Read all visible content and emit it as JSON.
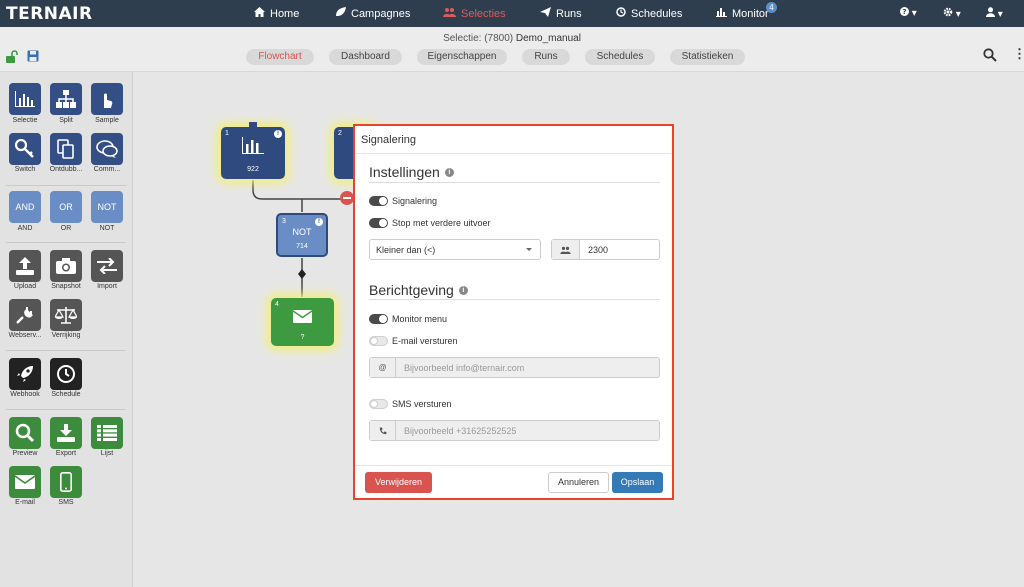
{
  "app": {
    "logo": "TERNAIR"
  },
  "nav": {
    "items": [
      {
        "label": "Home",
        "icon": "home-icon"
      },
      {
        "label": "Campagnes",
        "icon": "leaf-icon"
      },
      {
        "label": "Selecties",
        "icon": "users-icon",
        "active": true
      },
      {
        "label": "Runs",
        "icon": "paper-plane-icon"
      },
      {
        "label": "Schedules",
        "icon": "clock-icon"
      },
      {
        "label": "Monitor",
        "icon": "bar-chart-icon",
        "badge": "4"
      }
    ],
    "right": [
      "question-icon",
      "gear-icon",
      "user-icon"
    ]
  },
  "subheader": {
    "title_prefix": "Selectie: (7800)",
    "title_name": "Demo_manual",
    "tabs": [
      "Flowchart",
      "Dashboard",
      "Eigenschappen",
      "Runs",
      "Schedules",
      "Statistieken"
    ],
    "active_tab": "Flowchart"
  },
  "toolbar": {
    "groups": [
      [
        "Selectie",
        "Split",
        "Sample",
        "Switch",
        "Ontdubb...",
        "Comm..."
      ],
      [
        "AND",
        "OR",
        "NOT"
      ],
      [
        "Upload",
        "Snapshot",
        "Import",
        "Webserv...",
        "Verrijking"
      ],
      [
        "Webhook",
        "Schedule"
      ],
      [
        "Preview",
        "Export",
        "Lijst",
        "E-mail",
        "SMS"
      ]
    ],
    "logic_text": {
      "and": "AND",
      "or": "OR",
      "not": "NOT"
    }
  },
  "flow": {
    "node1": {
      "num": "1",
      "count": "922"
    },
    "node2": {
      "num": "2"
    },
    "node3": {
      "num": "3",
      "label": "NOT",
      "count": "714"
    },
    "node4": {
      "num": "4",
      "count": "?"
    }
  },
  "modal": {
    "title": "Signalering",
    "section1": "Instellingen",
    "toggle_signalering": "Signalering",
    "toggle_stop": "Stop met verdere uitvoer",
    "select_value": "Kleiner dan (<)",
    "threshold": "2300",
    "section2": "Berichtgeving",
    "toggle_monitor": "Monitor menu",
    "toggle_email": "E-mail versturen",
    "email_placeholder": "Bijvoorbeeld info@ternair.com",
    "toggle_sms": "SMS versturen",
    "sms_placeholder": "Bijvoorbeeld +31625252525",
    "btn_delete": "Verwijderen",
    "btn_cancel": "Annuleren",
    "btn_save": "Opslaan"
  },
  "colors": {
    "nav_bg": "#2f3e4e",
    "accent_red": "#d9534f",
    "node_blue": "#2e4a7e",
    "node_green": "#3d9a41",
    "tool_blue": "#344f86",
    "tool_lightblue": "#6a8dc6",
    "tool_gray": "#555555",
    "tool_dark": "#222222",
    "tool_green": "#3d8b3d",
    "primary": "#337ab7"
  }
}
